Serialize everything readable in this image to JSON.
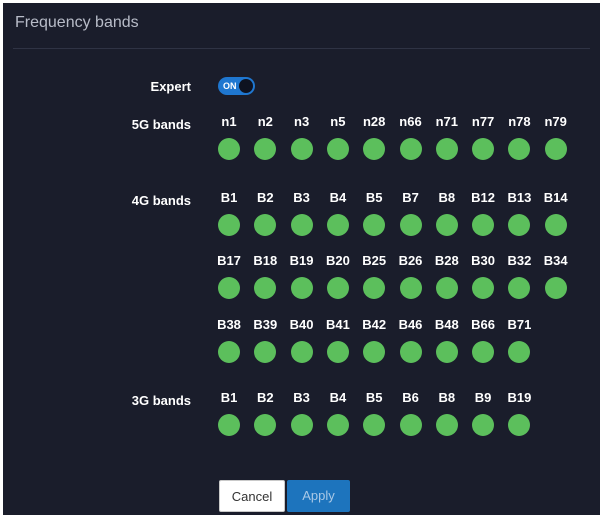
{
  "title": "Frequency bands",
  "expert": {
    "label": "Expert",
    "toggle_text": "ON",
    "state": true
  },
  "groups": [
    {
      "label": "5G bands",
      "rows": [
        [
          "n1",
          "n2",
          "n3",
          "n5",
          "n28",
          "n66",
          "n71",
          "n77",
          "n78",
          "n79"
        ]
      ]
    },
    {
      "label": "4G bands",
      "rows": [
        [
          "B1",
          "B2",
          "B3",
          "B4",
          "B5",
          "B7",
          "B8",
          "B12",
          "B13",
          "B14"
        ],
        [
          "B17",
          "B18",
          "B19",
          "B20",
          "B25",
          "B26",
          "B28",
          "B30",
          "B32",
          "B34"
        ],
        [
          "B38",
          "B39",
          "B40",
          "B41",
          "B42",
          "B46",
          "B48",
          "B66",
          "B71"
        ]
      ]
    },
    {
      "label": "3G bands",
      "rows": [
        [
          "B1",
          "B2",
          "B3",
          "B4",
          "B5",
          "B6",
          "B8",
          "B9",
          "B19"
        ]
      ]
    }
  ],
  "buttons": {
    "cancel": "Cancel",
    "apply": "Apply"
  },
  "colors": {
    "band_on": "#5cbf5c",
    "toggle_on": "#1f77d0",
    "panel_bg": "#1a1d2b",
    "apply_bg": "#1d74bd"
  }
}
